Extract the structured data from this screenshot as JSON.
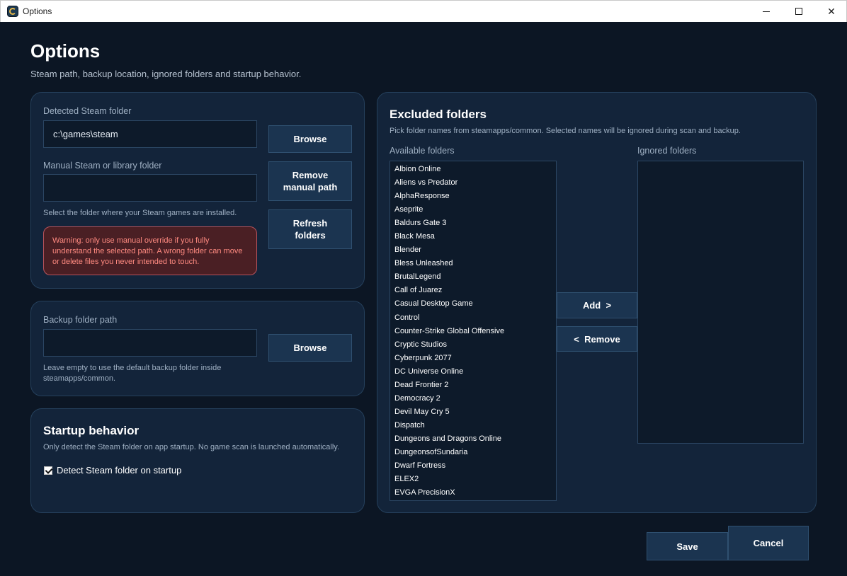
{
  "window": {
    "title": "Options"
  },
  "header": {
    "title": "Options",
    "subtitle": "Steam path, backup location, ignored folders and startup behavior."
  },
  "steam_card": {
    "detected_label": "Detected Steam folder",
    "detected_value": "c:\\games\\steam",
    "browse_label": "Browse",
    "manual_label": "Manual Steam or library folder",
    "manual_value": "",
    "remove_manual_label": "Remove manual path",
    "refresh_label": "Refresh folders",
    "hint": "Select the folder where your Steam games are installed.",
    "warning": "Warning: only use manual override if you fully understand the selected path. A wrong folder can move or delete files you never intended to touch."
  },
  "backup_card": {
    "label": "Backup folder path",
    "value": "",
    "browse_label": "Browse",
    "hint": "Leave empty to use the default backup folder inside steamapps/common."
  },
  "startup_card": {
    "title": "Startup behavior",
    "description": "Only detect the Steam folder on app startup. No game scan is launched automatically.",
    "checkbox_label": "Detect Steam folder on startup",
    "checkbox_checked": true
  },
  "excluded_card": {
    "title": "Excluded folders",
    "description": "Pick folder names from steamapps/common. Selected names will be ignored during scan and backup.",
    "available_label": "Available folders",
    "ignored_label": "Ignored folders",
    "add_label": "Add  >",
    "remove_label": "<  Remove",
    "available_folders": [
      "Albion Online",
      "Aliens vs Predator",
      "AlphaResponse",
      "Aseprite",
      "Baldurs Gate 3",
      "Black Mesa",
      "Blender",
      "Bless Unleashed",
      "BrutalLegend",
      "Call of Juarez",
      "Casual Desktop Game",
      "Control",
      "Counter-Strike Global Offensive",
      "Cryptic Studios",
      "Cyberpunk 2077",
      "DC Universe Online",
      "Dead Frontier 2",
      "Democracy 2",
      "Devil May Cry 5",
      "Dispatch",
      "Dungeons and Dragons Online",
      "DungeonsofSundaria",
      "Dwarf Fortress",
      "ELEX2",
      "EVGA PrecisionX"
    ],
    "ignored_folders": []
  },
  "footer": {
    "save_label": "Save",
    "cancel_label": "Cancel"
  }
}
